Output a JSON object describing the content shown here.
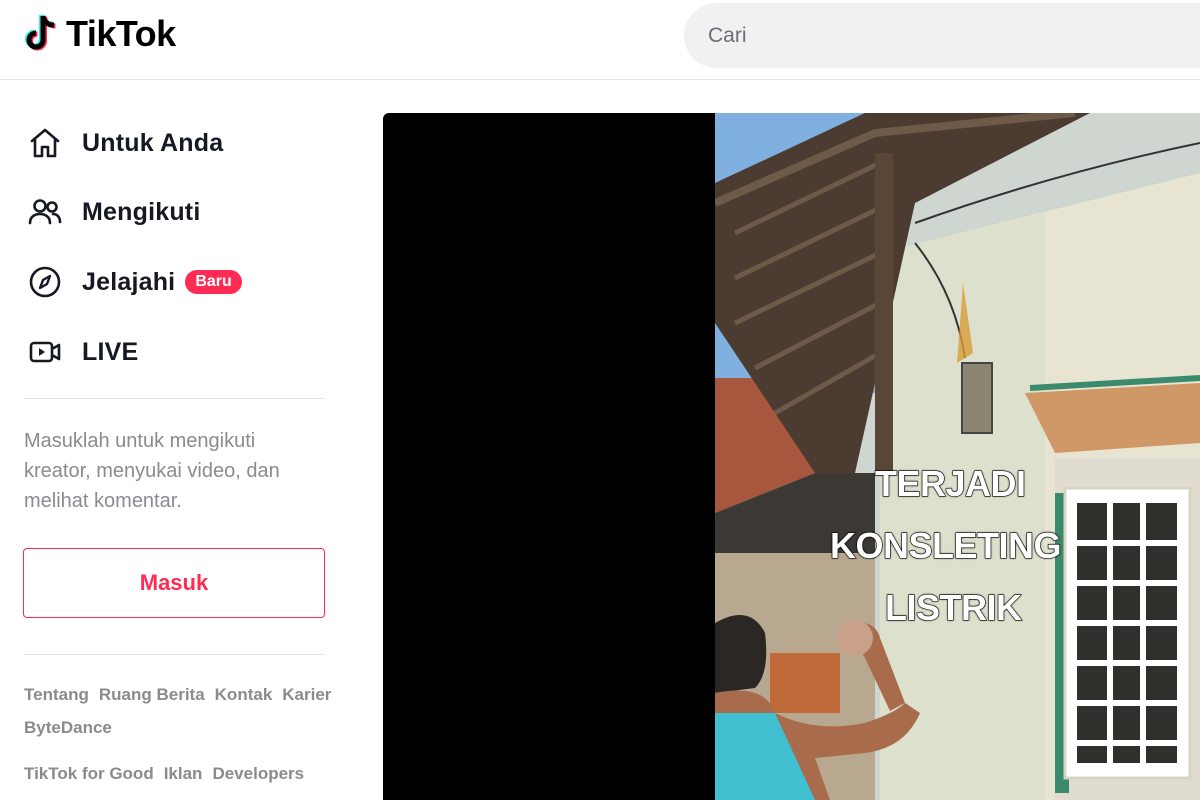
{
  "header": {
    "brand": "TikTok",
    "logo_icon": "tiktok-note-icon",
    "search_placeholder": "Cari"
  },
  "sidebar": {
    "nav": [
      {
        "label": "Untuk Anda",
        "icon": "home-icon"
      },
      {
        "label": "Mengikuti",
        "icon": "users-icon"
      },
      {
        "label": "Jelajahi",
        "icon": "compass-icon",
        "badge": "Baru"
      },
      {
        "label": "LIVE",
        "icon": "video-camera-icon"
      }
    ],
    "login_prompt": "Masuklah untuk mengikuti kreator, menyukai video, dan melihat komentar.",
    "login_button": "Masuk",
    "footer_row1": [
      "Tentang",
      "Ruang Berita",
      "Kontak",
      "Karier",
      "ByteDance"
    ],
    "footer_row2": [
      "TikTok for Good",
      "Iklan",
      "Developers"
    ]
  },
  "video": {
    "caption_lines": [
      "TERJADI",
      "KONSLETING",
      "LISTRIK"
    ]
  },
  "colors": {
    "accent": "#fe2c55",
    "text": "#161823",
    "muted": "#8a8b91"
  }
}
